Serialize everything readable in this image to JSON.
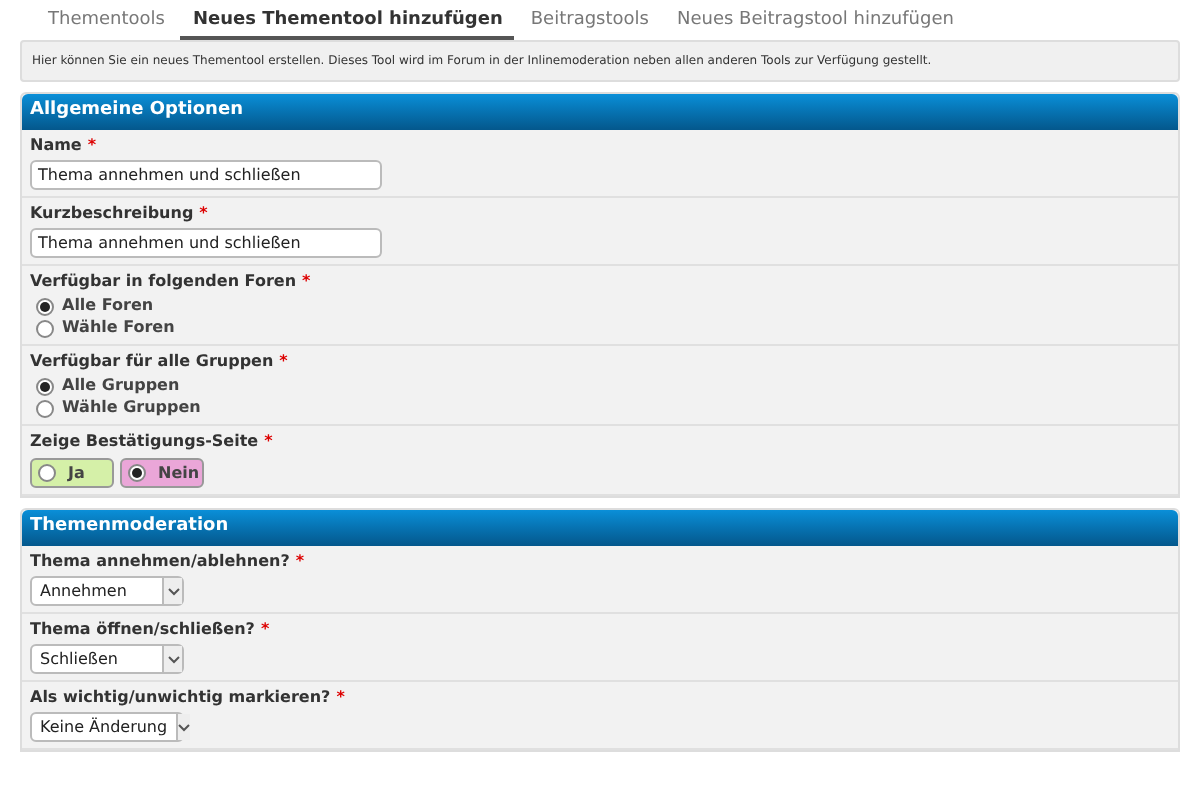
{
  "tabs": [
    {
      "label": "Thementools",
      "selected": false
    },
    {
      "label": "Neues Thementool hinzufügen",
      "selected": true
    },
    {
      "label": "Beitragstools",
      "selected": false
    },
    {
      "label": "Neues Beitragstool hinzufügen",
      "selected": false
    }
  ],
  "info": "Hier können Sie ein neues Thementool erstellen. Dieses Tool wird im Forum in der Inlinemoderation neben allen anderen Tools zur Verfügung gestellt.",
  "panels": [
    {
      "title": "Allgemeine Optionen",
      "rows": [
        {
          "kind": "text",
          "label": "Name",
          "required": "*",
          "value": "Thema annehmen und schließen"
        },
        {
          "kind": "text",
          "label": "Kurzbeschreibung",
          "required": "*",
          "value": "Thema annehmen und schließen"
        },
        {
          "kind": "radio",
          "label": "Verfügbar in folgenden Foren",
          "required": "*",
          "options": [
            {
              "label": "Alle Foren",
              "selected": true
            },
            {
              "label": "Wähle Foren",
              "selected": false
            }
          ]
        },
        {
          "kind": "radio",
          "label": "Verfügbar für alle Gruppen",
          "required": "*",
          "options": [
            {
              "label": "Alle Gruppen",
              "selected": true
            },
            {
              "label": "Wähle Gruppen",
              "selected": false
            }
          ]
        },
        {
          "kind": "yesno",
          "label": "Zeige Bestätigungs-Seite",
          "required": "*",
          "options": [
            {
              "label": "Ja",
              "selected": false,
              "color": "#d5f0a8"
            },
            {
              "label": "Nein",
              "selected": true,
              "color": "#eaa6d8"
            }
          ]
        }
      ]
    },
    {
      "title": "Themenmoderation",
      "rows": [
        {
          "kind": "select",
          "label": "Thema annehmen/ablehnen?",
          "required": "*",
          "value": "Annehmen"
        },
        {
          "kind": "select",
          "label": "Thema öffnen/schließen?",
          "required": "*",
          "value": "Schließen"
        },
        {
          "kind": "select",
          "label": "Als wichtig/unwichtig markieren?",
          "required": "*",
          "value": "Keine Änderung"
        }
      ]
    }
  ]
}
